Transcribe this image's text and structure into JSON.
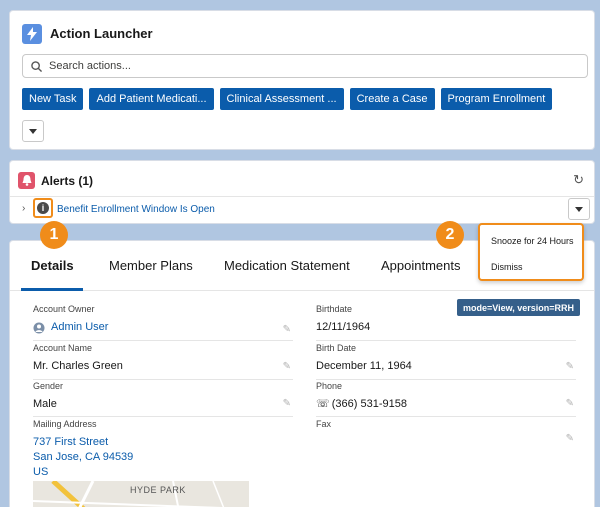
{
  "launcher": {
    "title": "Action Launcher",
    "search_placeholder": "Search actions...",
    "actions": [
      "New Task",
      "Add Patient Medicati...",
      "Clinical Assessment ...",
      "Create a Case",
      "Program Enrollment"
    ]
  },
  "alerts": {
    "title": "Alerts (1)",
    "item": "Benefit Enrollment Window Is Open",
    "menu": [
      "Snooze for 24 Hours",
      "Dismiss"
    ]
  },
  "callouts": [
    "1",
    "2"
  ],
  "tabs": [
    "Details",
    "Member Plans",
    "Medication Statement",
    "Appointments"
  ],
  "mode_badge": "mode=View, version=RRH",
  "fields": {
    "account_owner": {
      "label": "Account Owner",
      "value": "Admin User"
    },
    "birthdate": {
      "label": "Birthdate",
      "value": "12/11/1964"
    },
    "account_name": {
      "label": "Account Name",
      "value": "Mr. Charles Green"
    },
    "birth_date": {
      "label": "Birth Date",
      "value": "December 11, 1964"
    },
    "gender": {
      "label": "Gender",
      "value": "Male"
    },
    "phone": {
      "label": "Phone",
      "value": "(366) 531-9158"
    },
    "mailing_address": {
      "label": "Mailing Address",
      "lines": [
        "737 First Street",
        "San Jose, CA 94539",
        "US"
      ]
    },
    "fax": {
      "label": "Fax",
      "value": ""
    }
  },
  "map_label": "HYDE PARK",
  "colors": {
    "brand": "#0b5cab",
    "callout": "#f08c1a",
    "alert": "#e0546b"
  }
}
